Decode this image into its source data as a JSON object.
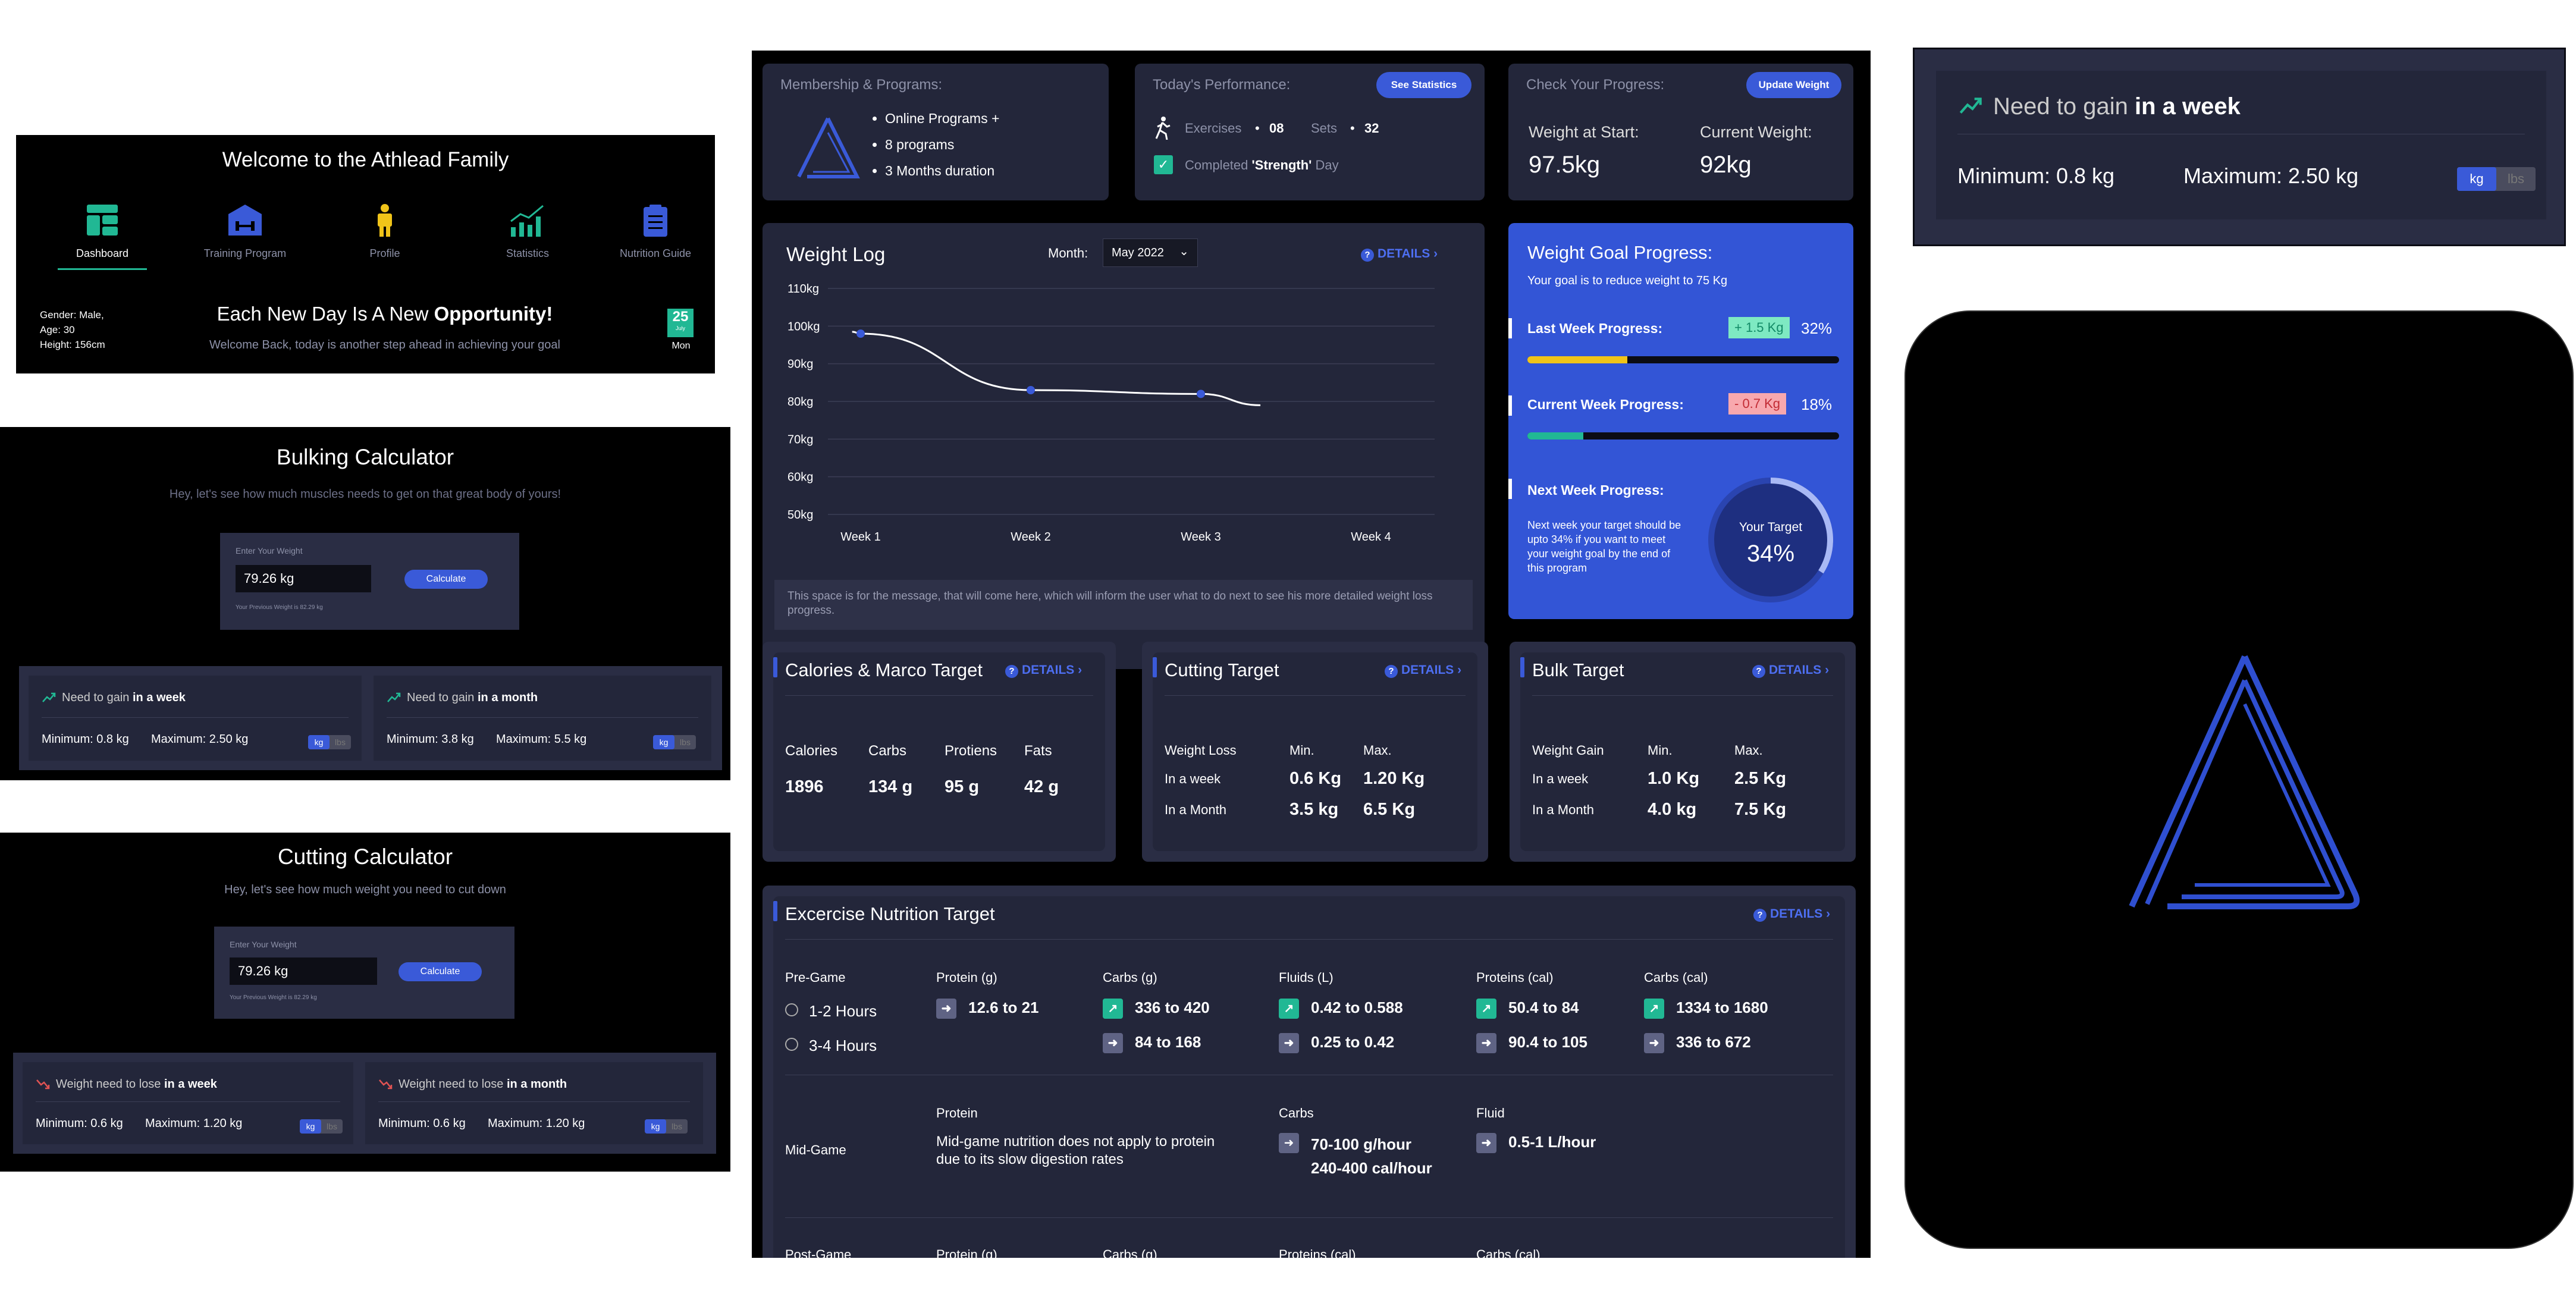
{
  "dashboard": {
    "title": "Welcome to the Athlead Family",
    "nav": [
      {
        "label": "Dashboard",
        "icon": "dashboard-icon",
        "active": true
      },
      {
        "label": "Training Program",
        "icon": "dumbbell-icon"
      },
      {
        "label": "Profile",
        "icon": "person-icon"
      },
      {
        "label": "Statistics",
        "icon": "chart-icon"
      },
      {
        "label": "Nutrition Guide",
        "icon": "clipboard-icon"
      }
    ],
    "profile": [
      "Gender: Male,",
      "Age: 30",
      "Height: 156cm"
    ],
    "headline_pre": "Each New Day Is A New ",
    "headline_bold": "Opportunity!",
    "subline": "Welcome Back, today is another step ahead in achieving your goal",
    "date_day": "25",
    "date_month": "July",
    "date_weekday": "Mon"
  },
  "bulking": {
    "title": "Bulking Calculator",
    "subtitle": "Hey, let's see how much muscles needs to get on that great body of yours!",
    "input_label": "Enter Your Weight",
    "input_value": "79.26 kg",
    "button": "Calculate",
    "previous": "Your Previous Weight is 82.29 kg",
    "cards": [
      {
        "pre": "Need to gain ",
        "bold": "in a week",
        "min": "Minimum: 0.8 kg",
        "max": "Maximum: 2.50 kg"
      },
      {
        "pre": "Need to gain ",
        "bold": "in a month",
        "min": "Minimum: 3.8 kg",
        "max": "Maximum: 5.5 kg"
      }
    ]
  },
  "cutting": {
    "title": "Cutting Calculator",
    "subtitle": "Hey, let's see how much weight you need to cut down",
    "input_label": "Enter Your Weight",
    "input_value": "79.26 kg",
    "button": "Calculate",
    "previous": "Your Previous Weight is 82.29 kg",
    "cards": [
      {
        "pre": "Weight need to lose ",
        "bold": "in a week",
        "min": "Minimum: 0.6 kg",
        "max": "Maximum: 1.20 kg"
      },
      {
        "pre": "Weight need to lose ",
        "bold": "in a month",
        "min": "Minimum: 0.6 kg",
        "max": "Maximum: 1.20 kg"
      }
    ]
  },
  "unit_toggle": {
    "kg": "kg",
    "lbs": "lbs"
  },
  "membership": {
    "title": "Membership & Programs:",
    "items": [
      "Online Programs +",
      "8 programs",
      "3 Months duration"
    ]
  },
  "performance": {
    "title": "Today's Performance:",
    "button": "See Statistics",
    "exercises_label": "Exercises",
    "exercises_value": "08",
    "sets_label": "Sets",
    "sets_value": "32",
    "completed_pre": "Completed ",
    "completed_bold": "'Strength'",
    "completed_post": " Day"
  },
  "progress_check": {
    "title": "Check Your Progress:",
    "button": "Update Weight",
    "start_label": "Weight at Start:",
    "start_value": "97.5kg",
    "current_label": "Current Weight:",
    "current_value": "92kg"
  },
  "weight_log": {
    "title": "Weight Log",
    "month_label": "Month:",
    "month_value": "May 2022",
    "details": "DETAILS",
    "message": "This space is for the message, that will come here, which will inform the user what to do next to see his more detailed weight loss progress."
  },
  "chart_data": {
    "type": "line",
    "categories": [
      "Week 1",
      "Week 2",
      "Week 3",
      "Week 4"
    ],
    "yticks": [
      "110kg",
      "100kg",
      "90kg",
      "80kg",
      "70kg",
      "60kg",
      "50kg"
    ],
    "ylim": [
      50,
      110
    ],
    "points": [
      {
        "x": 0.95,
        "y": 98.5
      },
      {
        "x": 1.0,
        "y": 98
      },
      {
        "x": 2.0,
        "y": 83
      },
      {
        "x": 3.0,
        "y": 82
      },
      {
        "x": 3.35,
        "y": 79
      }
    ],
    "markers": [
      1.0,
      2.0,
      3.0
    ],
    "grid": true,
    "color": "#ffffff",
    "marker_color": "#3a5ad8"
  },
  "goal": {
    "title": "Weight Goal Progress:",
    "subtitle": "Your goal is to reduce weight to 75 Kg",
    "last_label": "Last Week Progress:",
    "last_badge": "+ 1.5 Kg",
    "last_pct": "32%",
    "last_fraction": 0.32,
    "current_label": "Current Week Progress:",
    "current_badge": "- 0.7 Kg",
    "current_pct": "18%",
    "current_fraction": 0.18,
    "next_label": "Next Week Progress:",
    "next_text": "Next week your target should be upto 34% if you want to meet your weight goal by the end of this program",
    "target_label": "Your Target",
    "target_value": "34%",
    "target_fraction": 0.34
  },
  "calories": {
    "title": "Calories & Marco Target",
    "details": "DETAILS",
    "headers": [
      "Calories",
      "Carbs",
      "Protiens",
      "Fats"
    ],
    "values": [
      "1896",
      "134 g",
      "95 g",
      "42 g"
    ]
  },
  "cutting_target": {
    "title": "Cutting Target",
    "details": "DETAILS",
    "headers": [
      "Weight Loss",
      "Min.",
      "Max."
    ],
    "rows": [
      [
        "In a week",
        "0.6 Kg",
        "1.20 Kg"
      ],
      [
        "In a Month",
        "3.5 kg",
        "6.5 Kg"
      ]
    ]
  },
  "bulk_target": {
    "title": "Bulk Target",
    "details": "DETAILS",
    "headers": [
      "Weight Gain",
      "Min.",
      "Max."
    ],
    "rows": [
      [
        "In a week",
        "1.0 Kg",
        "2.5 Kg"
      ],
      [
        "In a Month",
        "4.0 kg",
        "7.5 Kg"
      ]
    ]
  },
  "nutrition": {
    "title": "Excercise Nutrition Target",
    "details": "DETAILS",
    "pre_label": "Pre-Game",
    "pre_headers": [
      "Protein (g)",
      "Carbs (g)",
      "Fluids (L)",
      "Proteins (cal)",
      "Carbs (cal)"
    ],
    "pre_rows": [
      {
        "time": "1-2 Hours",
        "values": [
          "12.6 to 21",
          "336 to 420",
          "0.42 to 0.588",
          "50.4 to 84",
          "1334 to 1680"
        ]
      },
      {
        "time": "3-4 Hours",
        "values": [
          "",
          "84 to 168",
          "0.25 to 0.42",
          "90.4 to 105",
          "336 to 672"
        ]
      }
    ],
    "mid_label": "Mid-Game",
    "mid_protein_label": "Protein",
    "mid_protein_text": "Mid-game nutrition does not apply to protein due to its slow digestion rates",
    "mid_carbs_label": "Carbs",
    "mid_carbs_1": "70-100 g/hour",
    "mid_carbs_2": "240-400 cal/hour",
    "mid_fluid_label": "Fluid",
    "mid_fluid_value": "0.5-1 L/hour",
    "post_label": "Post-Game",
    "post_headers": [
      "Protein (g)",
      "Carbs (g)",
      "Proteins (cal)",
      "Carbs (cal)"
    ]
  },
  "zoom_card": {
    "pre": "Need to gain ",
    "bold": "in a week",
    "min": "Minimum: 0.8 kg",
    "max": "Maximum: 2.50 kg"
  },
  "colors": {
    "accent": "#3a5ad8",
    "green": "#21b894",
    "yellow": "#f0c419",
    "panel": "#23263a",
    "bg": "#1a1c2a"
  }
}
